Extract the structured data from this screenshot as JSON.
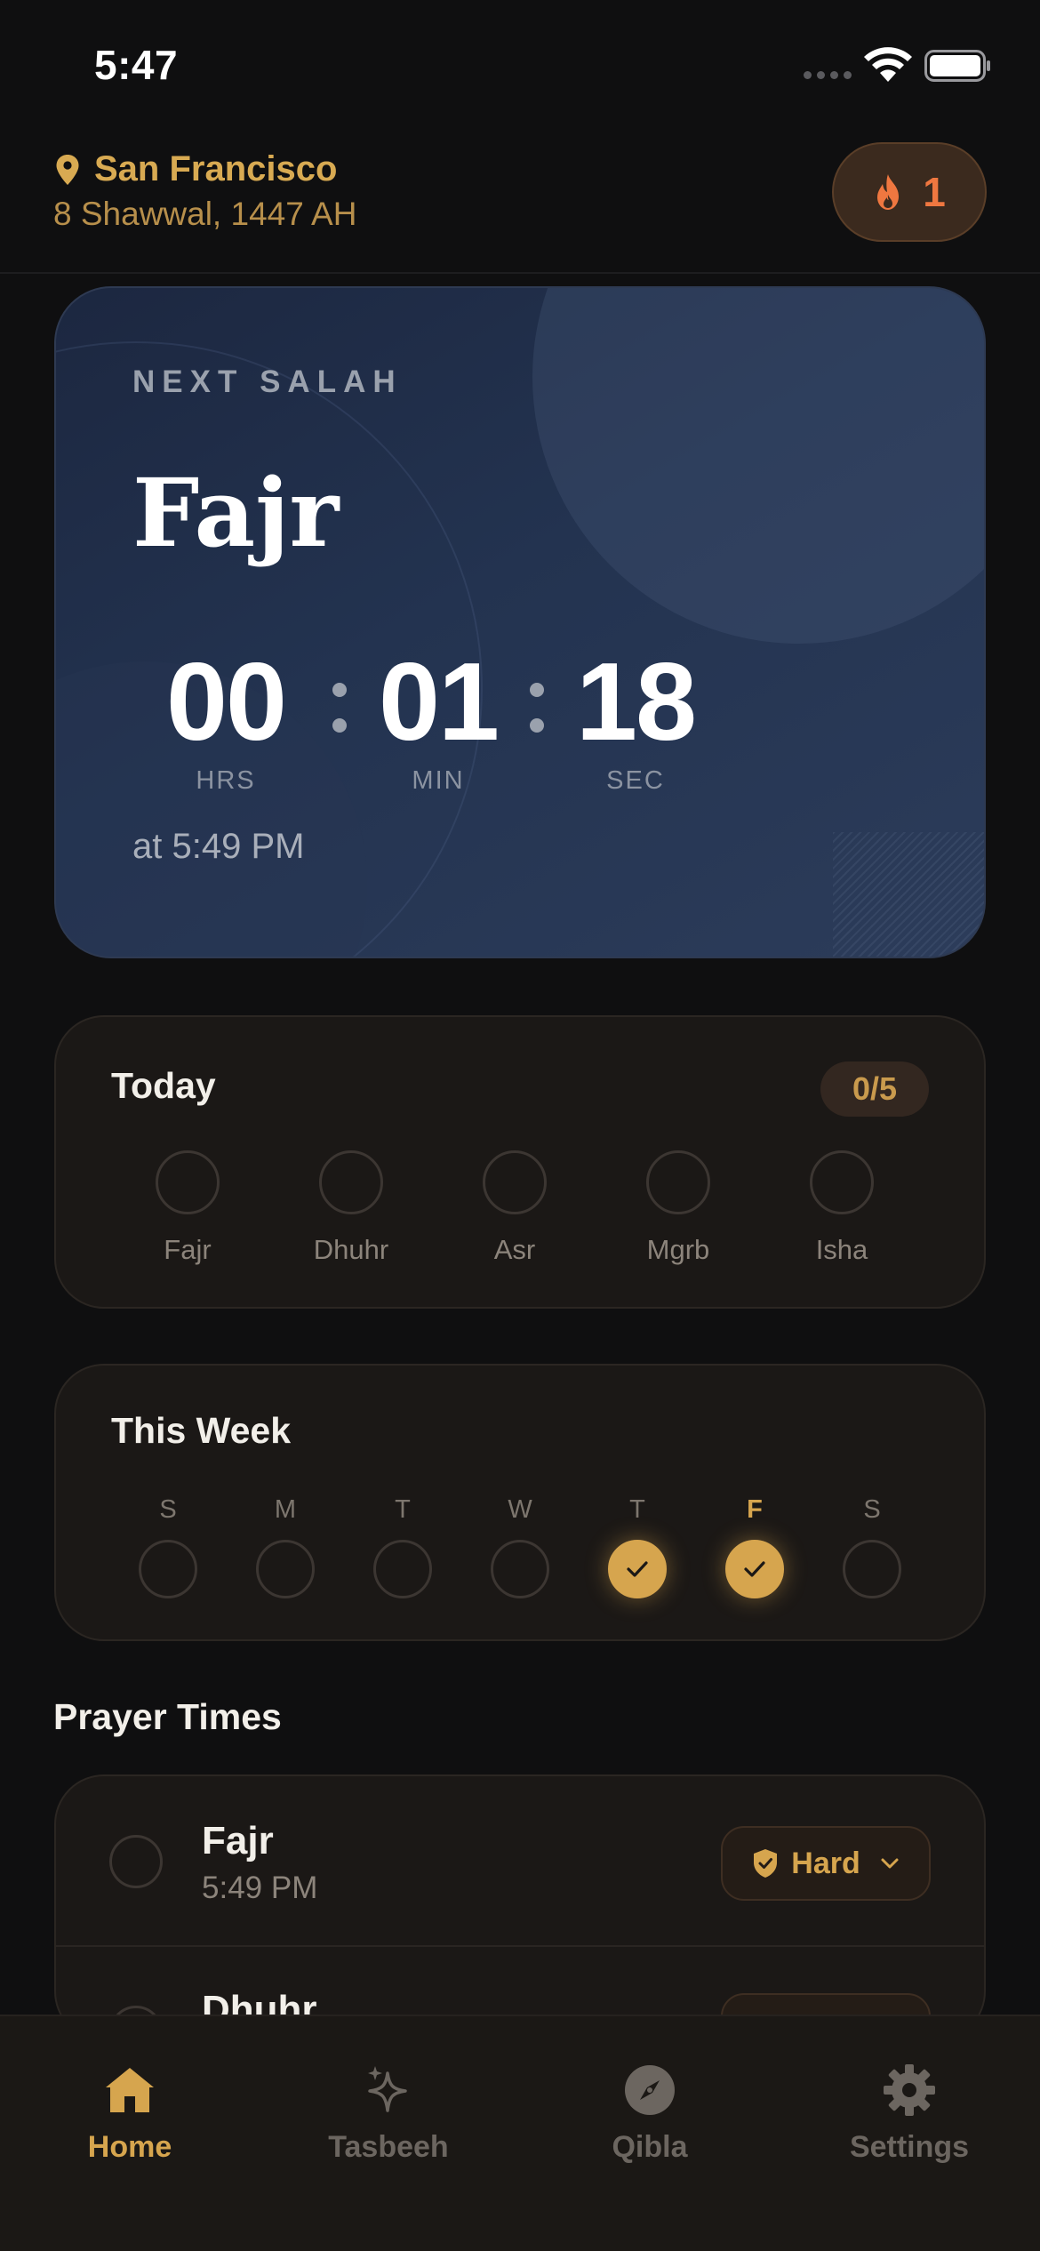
{
  "status": {
    "time": "5:47"
  },
  "header": {
    "city": "San Francisco",
    "hijri_date": "8 Shawwal, 1447 AH",
    "streak_count": "1"
  },
  "next_salah": {
    "label": "NEXT SALAH",
    "name": "Fajr",
    "countdown": [
      {
        "value": "00",
        "unit": "HRS"
      },
      {
        "value": "01",
        "unit": "MIN"
      },
      {
        "value": "18",
        "unit": "SEC"
      }
    ],
    "at_time": "at 5:49 PM"
  },
  "today": {
    "title": "Today",
    "progress": "0/5",
    "prayers": [
      "Fajr",
      "Dhuhr",
      "Asr",
      "Mgrb",
      "Isha"
    ]
  },
  "week": {
    "title": "This Week",
    "days": [
      {
        "label": "S",
        "done": false,
        "today": false
      },
      {
        "label": "M",
        "done": false,
        "today": false
      },
      {
        "label": "T",
        "done": false,
        "today": false
      },
      {
        "label": "W",
        "done": false,
        "today": false
      },
      {
        "label": "T",
        "done": true,
        "today": false
      },
      {
        "label": "F",
        "done": true,
        "today": true
      },
      {
        "label": "S",
        "done": false,
        "today": false
      }
    ]
  },
  "prayer_times": {
    "title": "Prayer Times",
    "rows": [
      {
        "name": "Fajr",
        "time": "5:49 PM",
        "difficulty": "Hard"
      },
      {
        "name": "Dhuhr",
        "time": "",
        "difficulty": ""
      }
    ]
  },
  "tabs": [
    {
      "label": "Home",
      "icon": "home-icon",
      "active": true
    },
    {
      "label": "Tasbeeh",
      "icon": "sparkle-icon",
      "active": false
    },
    {
      "label": "Qibla",
      "icon": "compass-icon",
      "active": false
    },
    {
      "label": "Settings",
      "icon": "gear-icon",
      "active": false
    }
  ],
  "colors": {
    "accent": "#d6a54e",
    "streak": "#ef7740",
    "background": "#0f0f10",
    "card": "#1b1816",
    "hero": "#233350"
  }
}
